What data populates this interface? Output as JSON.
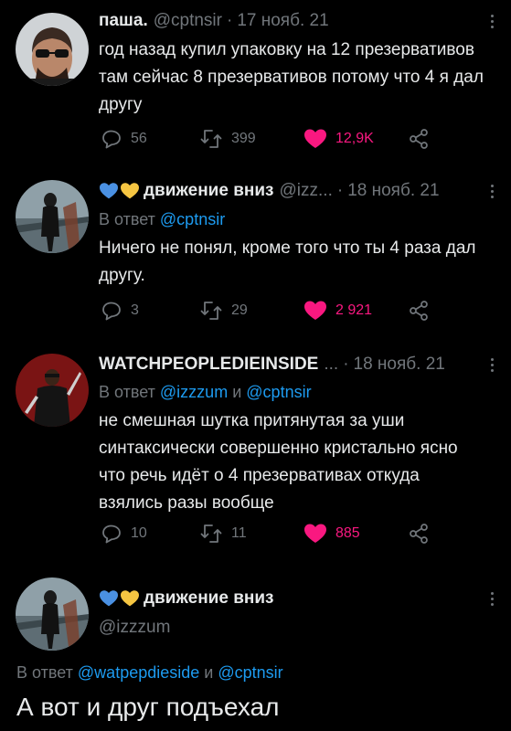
{
  "tweets": [
    {
      "name": "паша.",
      "handle": "@cptnsir",
      "date": "17 нояб. 21",
      "text": "год назад купил упаковку на 12 презервативов там сейчас 8 презервативов потому что 4 я дал другу",
      "replies": "56",
      "retweets": "399",
      "likes": "12,9K"
    },
    {
      "name": "движение вниз",
      "handle": "@izz...",
      "date": "18 нояб. 21",
      "reply_prefix": "В ответ",
      "reply_to": "@cptnsir",
      "text": "Ничего не понял, кроме того что ты 4 раза дал другу.",
      "replies": "3",
      "retweets": "29",
      "likes": "2 921"
    },
    {
      "name": "WATCHPEOPLEDIEINSIDE",
      "handle": "...",
      "date": "18 нояб. 21",
      "reply_prefix": "В ответ",
      "reply_to_1": "@izzzum",
      "reply_and": "и",
      "reply_to_2": "@cptnsir",
      "text": "не смешная шутка притянутая за уши синтаксически совершенно кристально ясно что речь идёт о 4 презервативах откуда взялись разы вообще",
      "replies": "10",
      "retweets": "11",
      "likes": "885"
    },
    {
      "name": "движение вниз",
      "handle": "@izzzum",
      "reply_prefix": "В ответ",
      "reply_to_1": "@watpepdieside",
      "reply_and": "и",
      "reply_to_2": "@cptnsir",
      "text": "А вот и друг подъехал"
    }
  ],
  "colors": {
    "background": "#000000",
    "text": "#e7e9ea",
    "muted": "#71767b",
    "link": "#1d9bf0",
    "like": "#f91880",
    "heart_blue": "#4a90e2",
    "heart_yellow": "#f5c542"
  },
  "icons": [
    "reply-icon",
    "retweet-icon",
    "like-icon",
    "share-icon",
    "more-icon",
    "blue-heart-emoji",
    "yellow-heart-emoji"
  ]
}
